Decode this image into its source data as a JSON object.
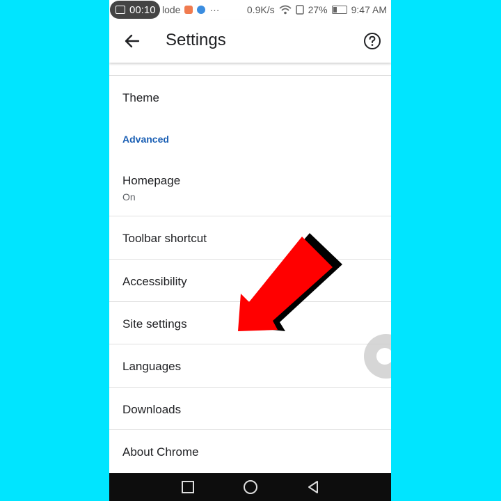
{
  "status_bar": {
    "recording_time": "00:10",
    "left_text": "lode",
    "menu_dots": "···",
    "network_speed": "0.9K/s",
    "battery_percent": "27%",
    "time": "9:47 AM"
  },
  "app_bar": {
    "title": "Settings",
    "back_icon": "arrow-left-icon",
    "help_icon": "help-circle-icon"
  },
  "settings": {
    "theme": "Theme",
    "advanced_header": "Advanced",
    "homepage": {
      "label": "Homepage",
      "sub": "On"
    },
    "toolbar_shortcut": "Toolbar shortcut",
    "accessibility": "Accessibility",
    "site_settings": "Site settings",
    "languages": "Languages",
    "downloads": "Downloads",
    "about_chrome": "About Chrome"
  },
  "colors": {
    "background": "#00e5ff",
    "section_header": "#1a5fb4",
    "arrow_red": "#ff0000",
    "nav_bar": "#0d0d0d"
  },
  "nav_bar": {
    "recents_icon": "square-icon",
    "home_icon": "circle-icon",
    "back_icon": "triangle-back-icon"
  }
}
